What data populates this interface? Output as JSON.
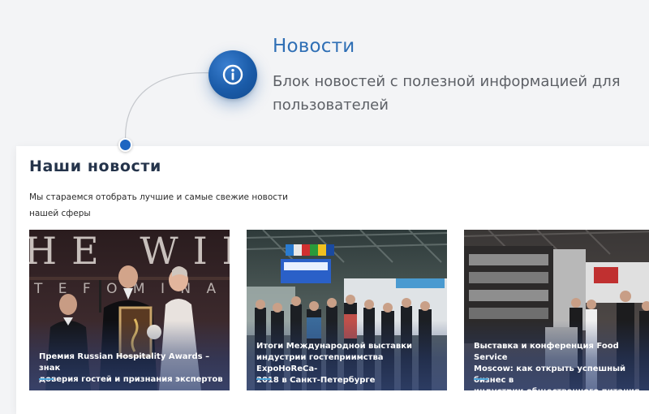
{
  "callout": {
    "title": "Новости",
    "description": "Блок новостей с полезной информацией для пользователей",
    "icon": "info-icon"
  },
  "news": {
    "title": "Наши новости",
    "subtitle": "Мы стараемся отобрать лучшие и самые свежие новости нашей сферы",
    "cards": [
      {
        "caption": "Премия Russian Hospitality Awards – знак\nдоверия гостей и признания экспертов"
      },
      {
        "caption": "Итоги Международной выставки\nиндустрии гостеприимства ExpoHoReCa-\n2018 в Санкт-Петербурге"
      },
      {
        "caption": "Выставка и конференция Food Service\nMoscow: как открыть успешный бизнес в\nиндустрии общественного питания"
      }
    ]
  },
  "colors": {
    "accent": "#1d65c1",
    "title_blue": "#2f6fb5",
    "heading": "#24334a"
  }
}
